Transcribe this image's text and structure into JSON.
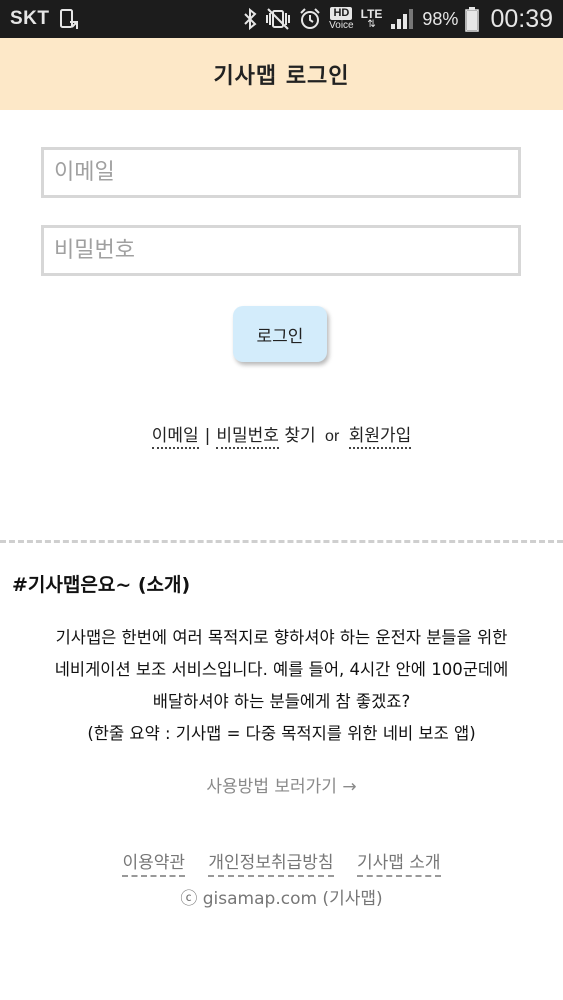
{
  "status_bar": {
    "carrier": "SKT",
    "hd_label": "HD",
    "voice_label": "Voice",
    "network_label": "LTE",
    "network_arrows": "⇅",
    "battery_percent": "98%",
    "battery_level": 0.98,
    "time": "00:39"
  },
  "header": {
    "title": "기사맵 로그인"
  },
  "login_form": {
    "email_placeholder": "이메일",
    "password_placeholder": "비밀번호",
    "login_button": "로그인"
  },
  "find_links": {
    "email": "이메일",
    "separator": "|",
    "password": "비밀번호",
    "find_text": "찾기",
    "or_text": "or",
    "signup": "회원가입"
  },
  "intro": {
    "title": "#기사맵은요~ (소개)",
    "lines": [
      "기사맵은 한번에 여러 목적지로 향하셔야 하는 운전자 분들을 위한",
      "네비게이션 보조 서비스입니다. 예를 들어, 4시간 안에 100군데에",
      "배달하셔야 하는 분들에게 참 좋겠죠?",
      "(한줄 요약 : 기사맵 = 다중 목적지를 위한 네비 보조 앱)"
    ],
    "howto_link": "사용방법 보러가기 →"
  },
  "footer": {
    "links": [
      "이용약관",
      "개인정보취급방침",
      "기사맵 소개"
    ],
    "copyright": "ⓒ gisamap.com (기사맵)"
  },
  "colors": {
    "status_bar_bg": "#1c1c1c",
    "header_bg": "#fde8c8",
    "login_button_bg": "#d3ecfb",
    "input_border": "#d7d7d7"
  }
}
